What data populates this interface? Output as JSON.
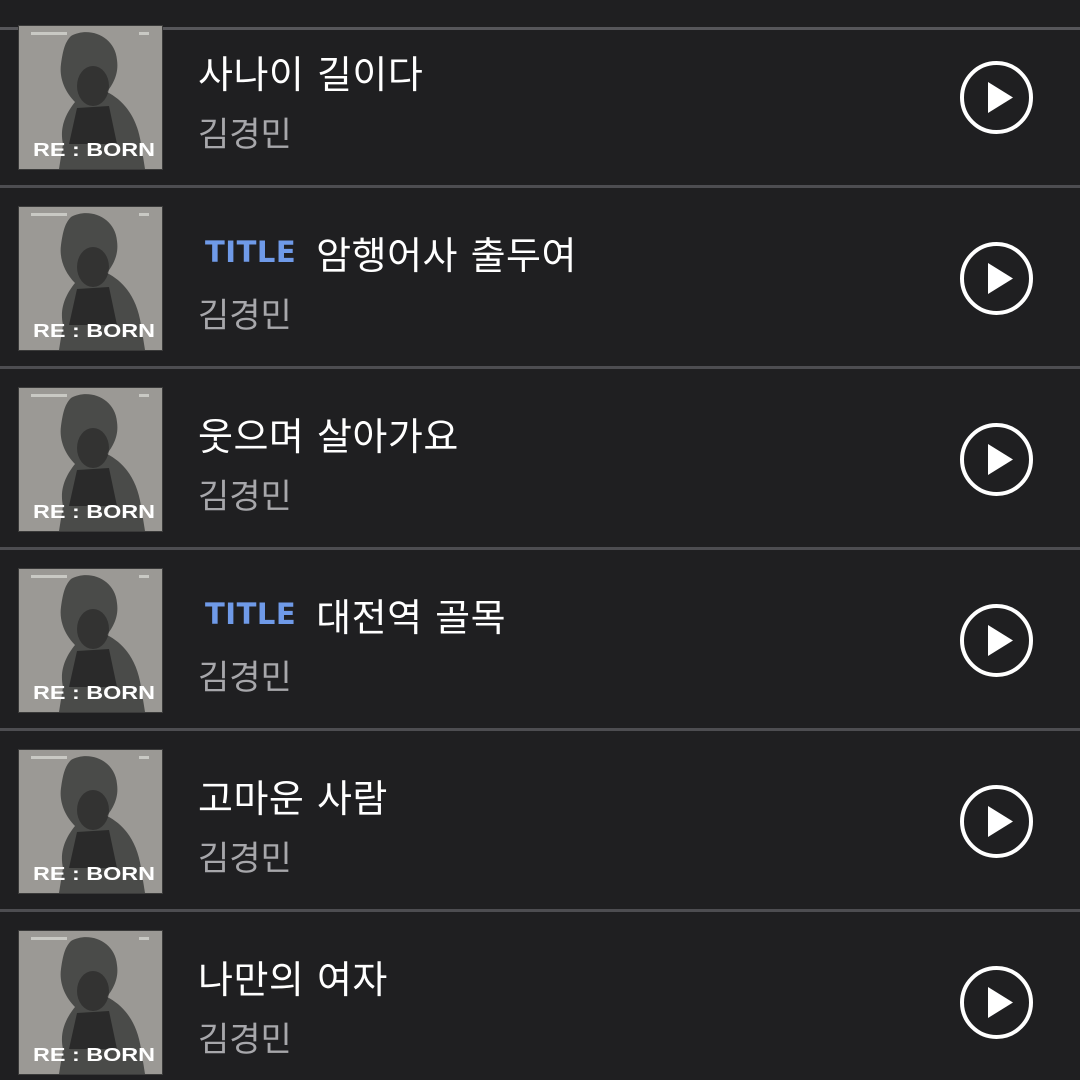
{
  "colors": {
    "background": "#1f1f21",
    "divider": "#4d4d51",
    "title_badge": "#6f9ae8",
    "track_title": "#ffffff",
    "track_artist": "#a7a7ab"
  },
  "album": {
    "art_label": "RE : BORN"
  },
  "tracks": [
    {
      "badge": "",
      "title": "사나이 길이다",
      "artist": "김경민",
      "play_icon": "play-circle-icon"
    },
    {
      "badge": "TITLE",
      "title": "암행어사 출두여",
      "artist": "김경민",
      "play_icon": "play-circle-icon"
    },
    {
      "badge": "",
      "title": "웃으며 살아가요",
      "artist": "김경민",
      "play_icon": "play-circle-icon"
    },
    {
      "badge": "TITLE",
      "title": "대전역 골목",
      "artist": "김경민",
      "play_icon": "play-circle-icon"
    },
    {
      "badge": "",
      "title": "고마운 사람",
      "artist": "김경민",
      "play_icon": "play-circle-icon"
    },
    {
      "badge": "",
      "title": "나만의 여자",
      "artist": "김경민",
      "play_icon": "play-circle-icon"
    }
  ]
}
